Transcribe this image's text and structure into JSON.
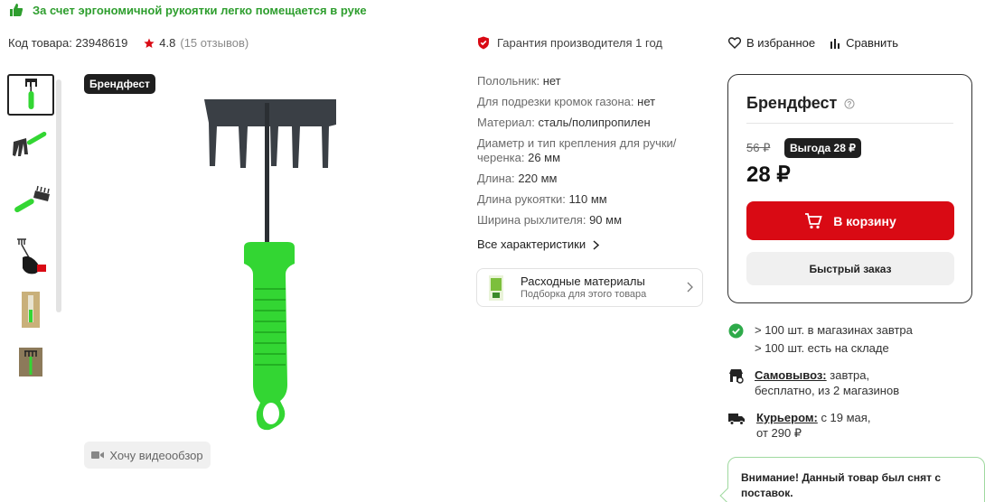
{
  "promo": {
    "text": "За счет эргономичной рукоятки легко помещается в руке"
  },
  "product": {
    "code_label": "Код товара:",
    "code_value": "23948619",
    "rating": "4.8",
    "reviews": "(15 отзывов)"
  },
  "guarantee": {
    "text": "Гарантия производителя 1 год"
  },
  "actions": {
    "favorite": "В избранное",
    "compare": "Сравнить"
  },
  "gallery": {
    "brand_tag": "Брендфест",
    "thumbnail_count": 6,
    "video_button": "Хочу видеообзор"
  },
  "specs": {
    "items": [
      {
        "key": "Полольник:",
        "value": "нет"
      },
      {
        "key": "Для подрезки кромок газона:",
        "value": "нет"
      },
      {
        "key": "Материал:",
        "value": "сталь/полипропилен"
      },
      {
        "key": "Диаметр и тип крепления для ручки/черенка:",
        "value": "26 мм"
      },
      {
        "key": "Длина:",
        "value": "220 мм"
      },
      {
        "key": "Длина рукоятки:",
        "value": "110 мм"
      },
      {
        "key": "Ширина рыхлителя:",
        "value": "90 мм"
      }
    ],
    "all_label": "Все характеристики"
  },
  "consumables": {
    "title": "Расходные материалы",
    "subtitle": "Подборка для этого товара"
  },
  "buybox": {
    "brand": "Брендфест",
    "old_price": "56 ₽",
    "benefit": "Выгода 28 ₽",
    "price": "28 ₽",
    "cart_button": "В корзину",
    "quick_order": "Быстрый заказ"
  },
  "availability": {
    "line1": "> 100 шт. в магазинах завтра",
    "line2": "> 100 шт. есть на складе"
  },
  "pickup": {
    "label": "Самовывоз:",
    "line1": "завтра,",
    "line2": "бесплатно, из 2 магазинов"
  },
  "courier": {
    "label": "Курьером:",
    "line1": "с 19 мая,",
    "line2": "от 290 ₽"
  },
  "notice": {
    "text": "Внимание! Данный товар был снят с поставок."
  },
  "colors": {
    "accent_red": "#d90a14",
    "promo_green": "#2e9e2e",
    "handle_green": "#33d633",
    "dark": "#1f1f1f"
  }
}
